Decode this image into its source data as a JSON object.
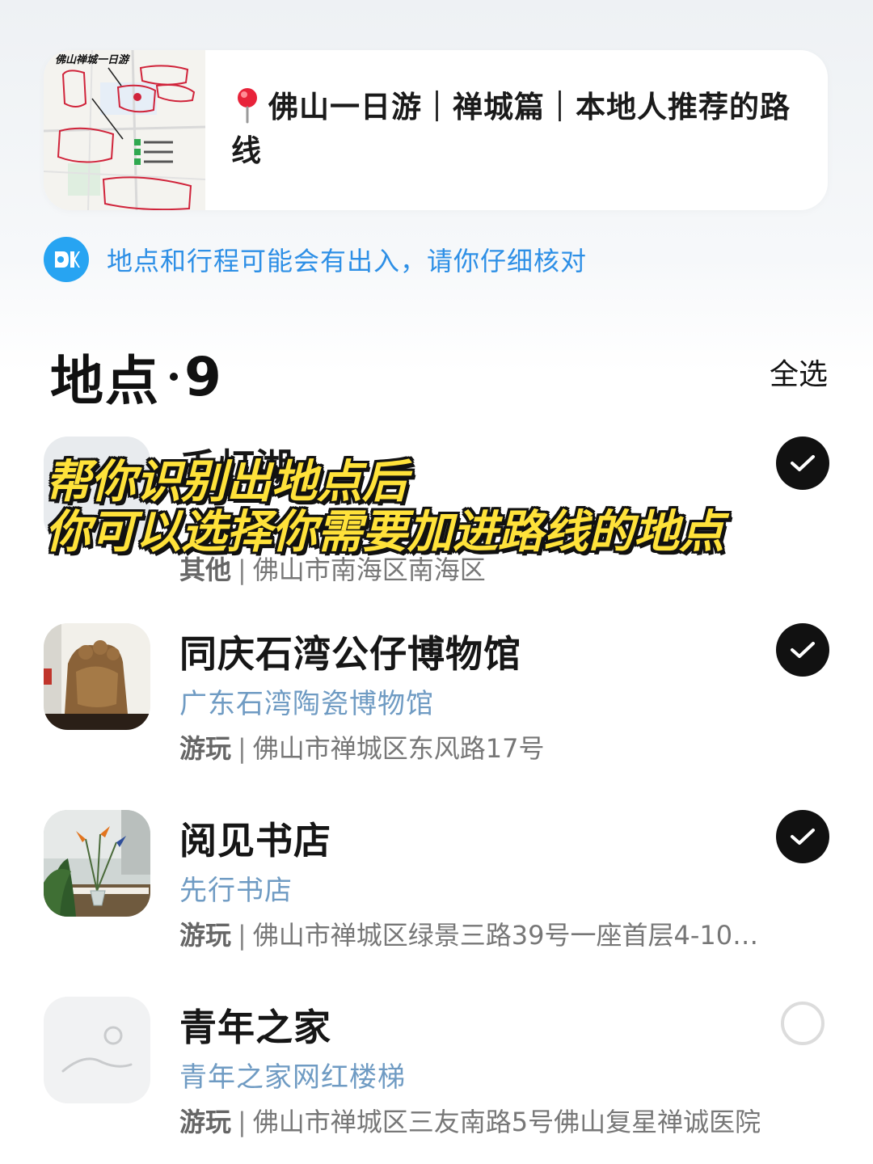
{
  "note": {
    "title": "佛山一日游｜禅城篇｜本地人推荐的路线",
    "thumb_title": "佛山禅城一日游"
  },
  "notice": {
    "text": "地点和行程可能会有出入，请你仔细核对",
    "icon": "ai-badge-icon"
  },
  "section": {
    "title": "地点",
    "count": "9",
    "select_all": "全选"
  },
  "places": [
    {
      "name": "千灯湖",
      "category": "其他",
      "address": "佛山市南海区南海区",
      "checked": true
    },
    {
      "name": "同庆石湾公仔博物馆",
      "alias": "广东石湾陶瓷博物馆",
      "category": "游玩",
      "address": "佛山市禅城区东风路17号",
      "checked": true
    },
    {
      "name": "阅见书店",
      "alias": "先行书店",
      "category": "游玩",
      "address": "佛山市禅城区绿景三路39号一座首层4-10…",
      "checked": true
    },
    {
      "name": "青年之家",
      "alias": "青年之家网红楼梯",
      "category": "游玩",
      "address": "佛山市禅城区三友南路5号佛山复星禅诚医院",
      "checked": false
    }
  ],
  "overlay": {
    "line1": "帮你识别出地点后",
    "line2": "你可以选择你需要加进路线的地点"
  },
  "colors": {
    "accent_blue": "#27a4f2",
    "notice_text": "#2d8fe6",
    "alias_text": "#6f9bc3",
    "overlay_yellow": "#ffe23a"
  }
}
